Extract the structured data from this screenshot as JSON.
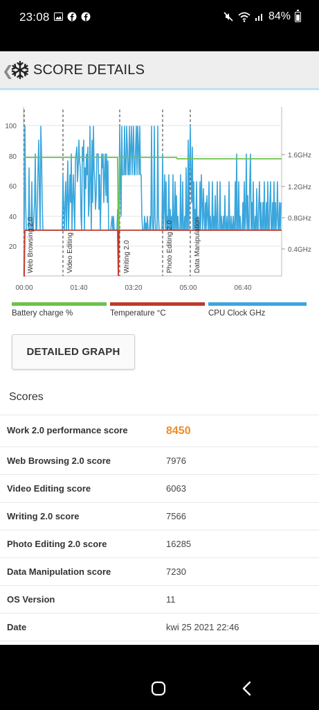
{
  "status": {
    "time": "23:08",
    "battery": "84%"
  },
  "header": {
    "title": "SCORE DETAILS"
  },
  "chart": {
    "y_ticks_left": [
      "100",
      "80",
      "60",
      "40",
      "20"
    ],
    "y_ticks_right": [
      "1.6GHz",
      "1.2GHz",
      "0.8GHz",
      "0.4GHz"
    ],
    "x_ticks": [
      "00:00",
      "01:40",
      "03:20",
      "05:00",
      "06:40"
    ],
    "section_labels": [
      "Web Browsing 2.0",
      "Video Editing",
      "Writing 2.0",
      "Photo Editing 2.0",
      "Data Manipulation"
    ]
  },
  "legend": [
    {
      "label": "Battery charge %",
      "color": "#6cc24a"
    },
    {
      "label": "Temperature °C",
      "color": "#c0392b"
    },
    {
      "label": "CPU Clock GHz",
      "color": "#3aa6dc"
    }
  ],
  "detail_button": "DETAILED GRAPH",
  "scores_title": "Scores",
  "scores": [
    {
      "name": "Work 2.0 performance score",
      "value": "8450"
    },
    {
      "name": "Web Browsing 2.0 score",
      "value": "7976"
    },
    {
      "name": "Video Editing score",
      "value": "6063"
    },
    {
      "name": "Writing 2.0 score",
      "value": "7566"
    },
    {
      "name": "Photo Editing 2.0 score",
      "value": "16285"
    },
    {
      "name": "Data Manipulation score",
      "value": "7230"
    },
    {
      "name": "OS Version",
      "value": "11"
    },
    {
      "name": "Date",
      "value": "kwi 25 2021 22:46"
    }
  ]
}
